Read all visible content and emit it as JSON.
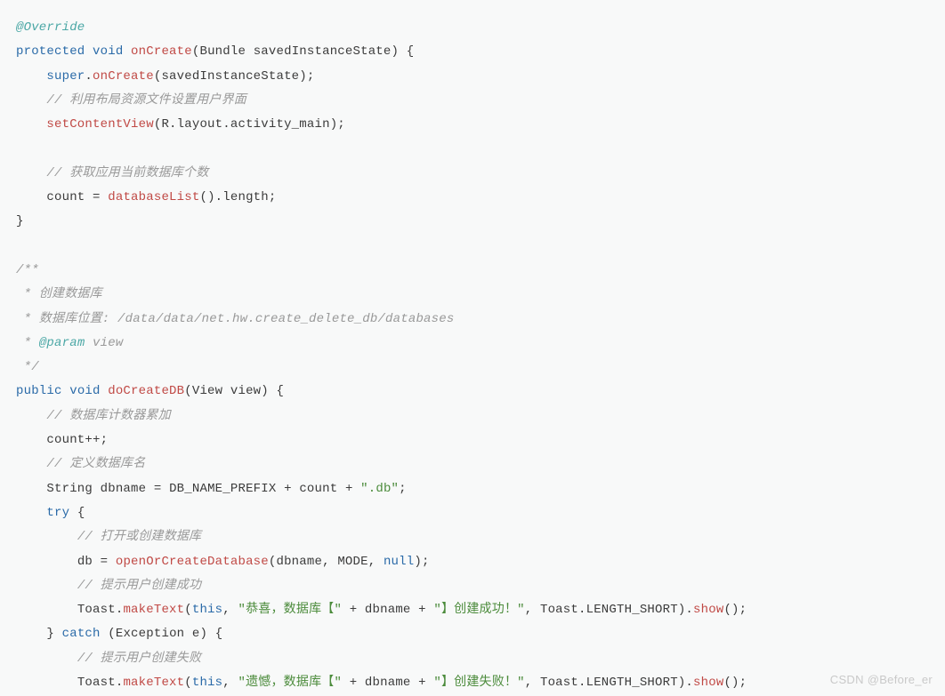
{
  "tokens": {
    "ann_override": "@Override",
    "kw_protected": "protected",
    "kw_void": "void",
    "kw_public": "public",
    "kw_try": "try",
    "kw_catch": "catch",
    "kw_this": "this",
    "kw_null": "null",
    "kw_super": "super",
    "m_onCreate": "onCreate",
    "m_setContentView": "setContentView",
    "m_databaseList": "databaseList",
    "m_doCreateDB": "doCreateDB",
    "m_openOrCreateDatabase": "openOrCreateDatabase",
    "m_makeText": "makeText",
    "m_show": "show",
    "t_Bundle": "Bundle",
    "t_View": "View",
    "t_String": "String",
    "t_Exception": "Exception",
    "t_Toast": "Toast",
    "t_R": "R",
    "id_savedInstanceState": "savedInstanceState",
    "id_layout": "layout",
    "id_activity_main": "activity_main",
    "id_count": "count",
    "id_length": "length",
    "id_dbname": "dbname",
    "id_db": "db",
    "id_view": "view",
    "id_e": "e",
    "const_DB_NAME_PREFIX": "DB_NAME_PREFIX",
    "const_MODE": "MODE",
    "const_LENGTH_SHORT": "LENGTH_SHORT",
    "cmt_layout": "// 利用布局资源文件设置用户界面",
    "cmt_getcount": "// 获取应用当前数据库个数",
    "cmt_block1": "/**",
    "cmt_block2": " * 创建数据库",
    "cmt_block3": " * 数据库位置: /data/data/net.hw.create_delete_db/databases",
    "cmt_block4_a": " * ",
    "cmt_block4_b": "@param",
    "cmt_block4_c": " view",
    "cmt_block5": " */",
    "cmt_counter": "// 数据库计数器累加",
    "cmt_defname": "// 定义数据库名",
    "cmt_openorcreate": "// 打开或创建数据库",
    "cmt_successhint": "// 提示用户创建成功",
    "cmt_failhint": "// 提示用户创建失败",
    "str_db": "\".db\"",
    "str_success1": "\"恭喜，数据库【\"",
    "str_success2": "\"】创建成功！\"",
    "str_fail1": "\"遗憾，数据库【\"",
    "str_fail2": "\"】创建失败！\""
  },
  "watermark": "CSDN @Before_er"
}
